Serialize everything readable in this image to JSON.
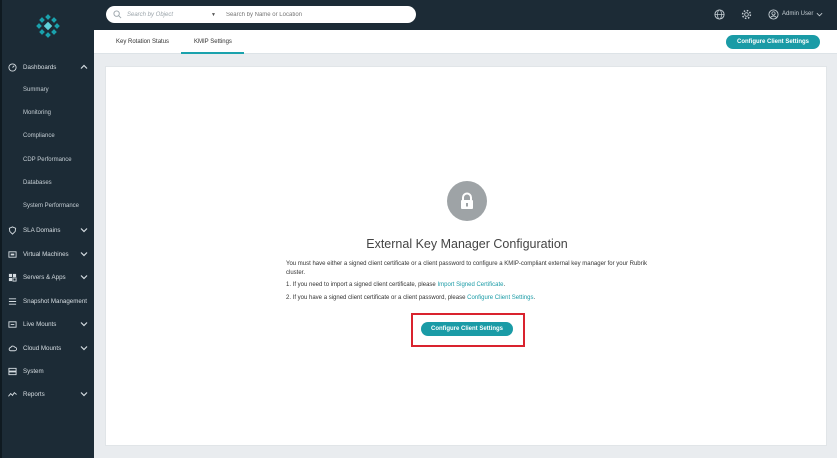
{
  "sidebar": {
    "items": [
      {
        "label": "Dashboards",
        "icon": "dashboard-icon",
        "expanded": true
      },
      {
        "label": "SLA Domains",
        "icon": "shield-icon"
      },
      {
        "label": "Virtual Machines",
        "icon": "vm-icon"
      },
      {
        "label": "Servers & Apps",
        "icon": "server-icon"
      },
      {
        "label": "Snapshot Management",
        "icon": "snapshot-icon"
      },
      {
        "label": "Live Mounts",
        "icon": "live-mount-icon"
      },
      {
        "label": "Cloud Mounts",
        "icon": "cloud-icon"
      },
      {
        "label": "System",
        "icon": "system-icon"
      },
      {
        "label": "Reports",
        "icon": "reports-icon"
      }
    ],
    "dashboard_subitems": [
      "Summary",
      "Monitoring",
      "Compliance",
      "CDP Performance",
      "Databases",
      "System Performance"
    ]
  },
  "topbar": {
    "search_object": "Search by Object",
    "search_placeholder": "Search by Name or Location",
    "user": "Admin User"
  },
  "tabs": {
    "key_rotation": "Key Rotation Status",
    "kmip": "KMIP Settings",
    "active": "KMIP Settings"
  },
  "toolbar": {
    "configure_label": "Configure Client Settings"
  },
  "main": {
    "title": "External Key Manager Configuration",
    "description": "You must have either a signed client certificate or a client password to configure a KMIP-compliant external key manager for your Rubrik cluster.",
    "step1_prefix": "1. If you need to import a signed client certificate, please",
    "step1_link": "Import Signed Certificate",
    "step2_prefix": "2. If you have a signed client certificate or a client password, please",
    "step2_link": "Configure Client Settings",
    "button_label": "Configure Client Settings"
  },
  "colors": {
    "accent": "#1a9ba6",
    "sidebar_bg": "#1c2b36",
    "highlight": "#d9232e"
  }
}
